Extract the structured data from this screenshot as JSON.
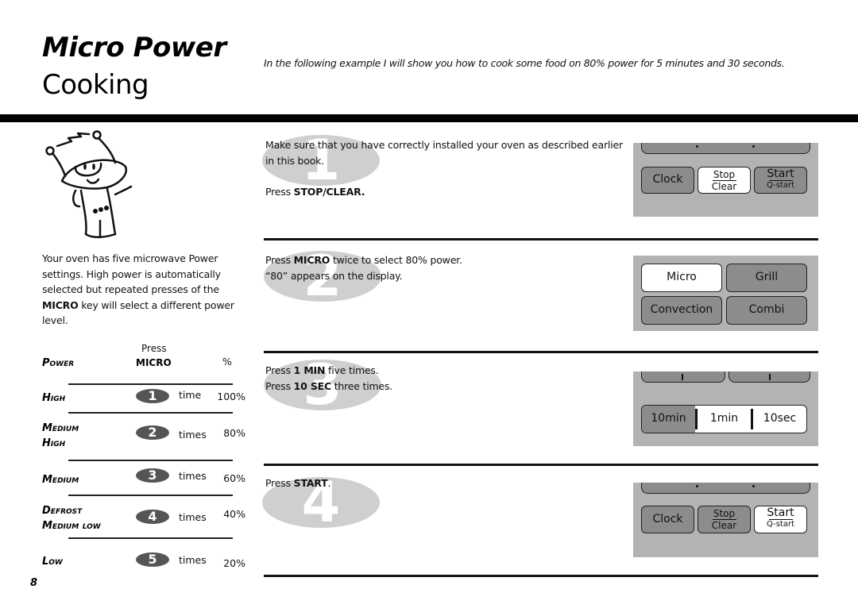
{
  "header": {
    "title_main": "Micro Power",
    "title_sub": "Cooking",
    "intro": "In the following example I will show you how to cook some food on 80% power for 5 minutes and 30 seconds."
  },
  "left": {
    "desc_pre": "Your oven has five microwave Power settings. High power is automatically selected but repeated presses of the ",
    "desc_bold": "MICRO",
    "desc_post": " key will select a different power level.",
    "table": {
      "head_press": "Press",
      "head_power": "Power",
      "head_micro": "MICRO",
      "head_pct": "%",
      "rows": [
        {
          "label": "High",
          "label2": "",
          "badge": "1",
          "times": "time",
          "pct": "100%"
        },
        {
          "label": "Medium",
          "label2": "High",
          "badge": "2",
          "times": "times",
          "pct": "80%"
        },
        {
          "label": "Medium",
          "label2": "",
          "badge": "3",
          "times": "times",
          "pct": "60%"
        },
        {
          "label": "Defrost",
          "label2": "Medium low",
          "badge": "4",
          "times": "times",
          "pct": "40%"
        },
        {
          "label": "Low",
          "label2": "",
          "badge": "5",
          "times": "times",
          "pct": "20%"
        }
      ]
    }
  },
  "steps": [
    {
      "num": "1",
      "line1": "Make sure that you have correctly installed your oven as described earlier in this book.",
      "line2_pre": "Press ",
      "line2_bold": "STOP/CLEAR.",
      "line2_post": ""
    },
    {
      "num": "2",
      "line1_pre": "Press ",
      "line1_bold": "MICRO",
      "line1_post": " twice to select 80% power.",
      "line2": "“80” appears on the display."
    },
    {
      "num": "3",
      "line1_pre": "Press ",
      "line1_bold": "1 MIN",
      "line1_post": " five times.",
      "line2_pre": "Press ",
      "line2_bold": "10 SEC",
      "line2_post": " three times."
    },
    {
      "num": "4",
      "line1_pre": "Press ",
      "line1_bold": "START",
      "line1_post": "."
    }
  ],
  "panels": {
    "p1": {
      "clock": "Clock",
      "stop": "Stop",
      "clear": "Clear",
      "start": "Start",
      "qstart": "Q-start",
      "highlight": "stop"
    },
    "p2": {
      "micro": "Micro",
      "grill": "Grill",
      "convection": "Convection",
      "combi": "Combi",
      "highlight": "micro"
    },
    "p3": {
      "ten_min": "10min",
      "one_min": "1min",
      "ten_sec": "10sec"
    },
    "p4": {
      "clock": "Clock",
      "stop": "Stop",
      "clear": "Clear",
      "start": "Start",
      "qstart": "Q-start",
      "highlight": "start"
    }
  },
  "page_number": "8"
}
